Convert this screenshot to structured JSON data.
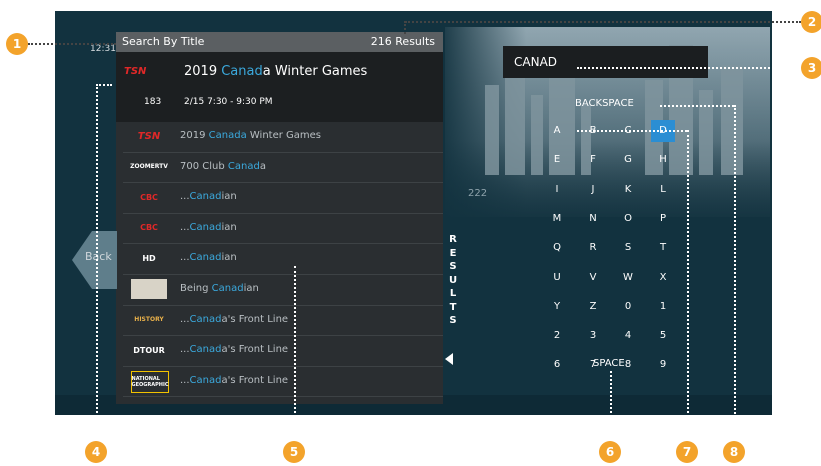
{
  "header": {
    "title": "Search By Title",
    "results_count": "216 Results",
    "clock": "12:31"
  },
  "featured": {
    "logo": "TSN",
    "title_prefix": "2019 ",
    "title_hl": "Canad",
    "title_suffix": "a Winter Games",
    "channel": "183",
    "time": "2/15  7:30 - 9:30 PM"
  },
  "list": [
    {
      "logo": "TSN",
      "pre": "2019 ",
      "hl": "Canada",
      "post": " Winter Games"
    },
    {
      "logo": "ZOOMERTV",
      "pre": "700 Club ",
      "hl": "Canad",
      "post": "a"
    },
    {
      "logo": "CBC",
      "pre": "...",
      "hl": "Canad",
      "post": "ian"
    },
    {
      "logo": "CBC",
      "pre": "...",
      "hl": "Canad",
      "post": "ian"
    },
    {
      "logo": "HD",
      "pre": "...",
      "hl": "Canad",
      "post": "ian"
    },
    {
      "logo": "",
      "pre": "Being ",
      "hl": "Canad",
      "post": "ian"
    },
    {
      "logo": "HISTORY",
      "pre": "...",
      "hl": "Canad",
      "post": "a's Front Line"
    },
    {
      "logo": "DTOUR",
      "pre": "...",
      "hl": "Canad",
      "post": "a's Front Line"
    },
    {
      "logo": "NATIONAL GEOGRAPHIC",
      "pre": "...",
      "hl": "Canad",
      "post": "a's Front Line"
    }
  ],
  "back_label": "Back",
  "results_vertical": [
    "R",
    "E",
    "S",
    "U",
    "L",
    "T",
    "S"
  ],
  "channel_number_box": "222",
  "search_input": {
    "value": "CANAD"
  },
  "keyboard": {
    "backspace": "BACKSPACE",
    "space": "SPACE",
    "rows": [
      [
        "A",
        "B",
        "C",
        "D"
      ],
      [
        "E",
        "F",
        "G",
        "H"
      ],
      [
        "I",
        "J",
        "K",
        "L"
      ],
      [
        "M",
        "N",
        "O",
        "P"
      ],
      [
        "Q",
        "R",
        "S",
        "T"
      ],
      [
        "U",
        "V",
        "W",
        "X"
      ],
      [
        "Y",
        "Z",
        "0",
        "1"
      ],
      [
        "2",
        "3",
        "4",
        "5"
      ],
      [
        "6",
        "7",
        "8",
        "9"
      ]
    ],
    "selected": "D"
  },
  "callouts": [
    "1",
    "2",
    "3",
    "4",
    "5",
    "6",
    "7",
    "8"
  ],
  "colors": {
    "accent": "#3ba9dd",
    "selected_key": "#2b8ed3",
    "callout": "#f3a32b",
    "panel": "#2a2e31",
    "screen": "#12323f"
  }
}
